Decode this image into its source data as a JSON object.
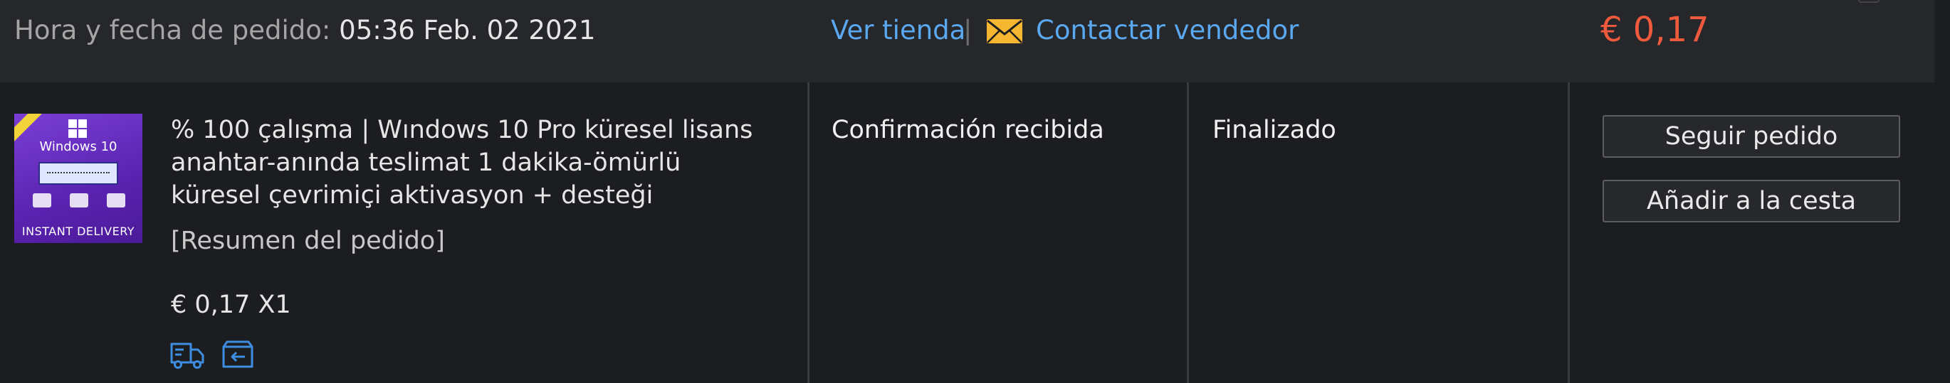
{
  "order_header": {
    "date_label": "Hora y fecha de pedido:",
    "date_value": "05:36 Feb. 02 2021",
    "store_link": "Ver tienda",
    "separator": "|",
    "contact_link": "Contactar vendedor",
    "total": "€ 0,17"
  },
  "product": {
    "thumbnail": {
      "title": "Windows 10",
      "footer": "INSTANT DELIVERY"
    },
    "title": "% 100 çalışma | Wındows 10 Pro küresel lisans anahtar-anında teslimat 1 dakika-ömürlü küresel çevrimiçi aktivasyon + desteği",
    "summary_link": "[Resumen del pedido]",
    "price_qty": "€ 0,17 X1",
    "service_icons": [
      "shipping-truck-icon",
      "return-box-icon"
    ]
  },
  "status": {
    "confirmation": "Confirmación recibida",
    "order_state": "Finalizado"
  },
  "actions": {
    "track_label": "Seguir pedido",
    "add_cart_label": "Añadir a la cesta"
  },
  "colors": {
    "link": "#5aa9f0",
    "price_accent": "#ef5a3c",
    "icon_blue": "#3d8de0",
    "mail_icon": "#f5b731"
  }
}
